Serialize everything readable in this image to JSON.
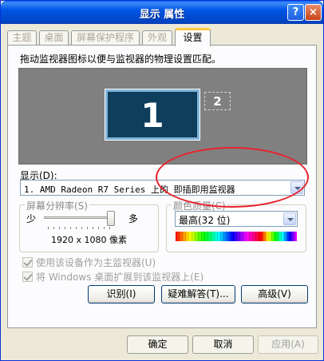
{
  "window": {
    "title": "显示 属性",
    "help_label": "?",
    "close_label": "×"
  },
  "tabs": [
    {
      "label": "主题",
      "active": false
    },
    {
      "label": "桌面",
      "active": false
    },
    {
      "label": "屏幕保护程序",
      "active": false
    },
    {
      "label": "外观",
      "active": false
    },
    {
      "label": "设置",
      "active": true
    }
  ],
  "settings": {
    "instruction": "拖动监视器图标以便与监视器的物理设置匹配。",
    "monitors": [
      {
        "number": "1",
        "primary": true
      },
      {
        "number": "2",
        "primary": false
      }
    ],
    "display_label": "显示(D):",
    "display_value": "1. AMD Radeon R7 Series 上的 即插即用监视器",
    "resolution": {
      "group_title": "屏幕分辨率(S)",
      "less_label": "少",
      "more_label": "多",
      "slider_level": 1.0,
      "value": "1920 x 1080 像素"
    },
    "color_quality": {
      "group_title": "颜色质量(C)",
      "value": "最高(32 位)"
    },
    "checkboxes": [
      {
        "label": "使用该设备作为主监视器(U)",
        "checked": true,
        "enabled": false
      },
      {
        "label": "将 Windows 桌面扩展到该监视器上(E)",
        "checked": true,
        "enabled": false
      }
    ],
    "buttons": {
      "identify": "识别(I)",
      "troubleshoot": "疑难解答(T)...",
      "advanced": "高级(V)"
    }
  },
  "footer": {
    "ok": "确定",
    "cancel": "取消",
    "apply": "应用(A)"
  },
  "colors": {
    "annotation": "#e8242c",
    "title_bar": "#0055e5",
    "monitor_fill": "#0f3d5c"
  }
}
